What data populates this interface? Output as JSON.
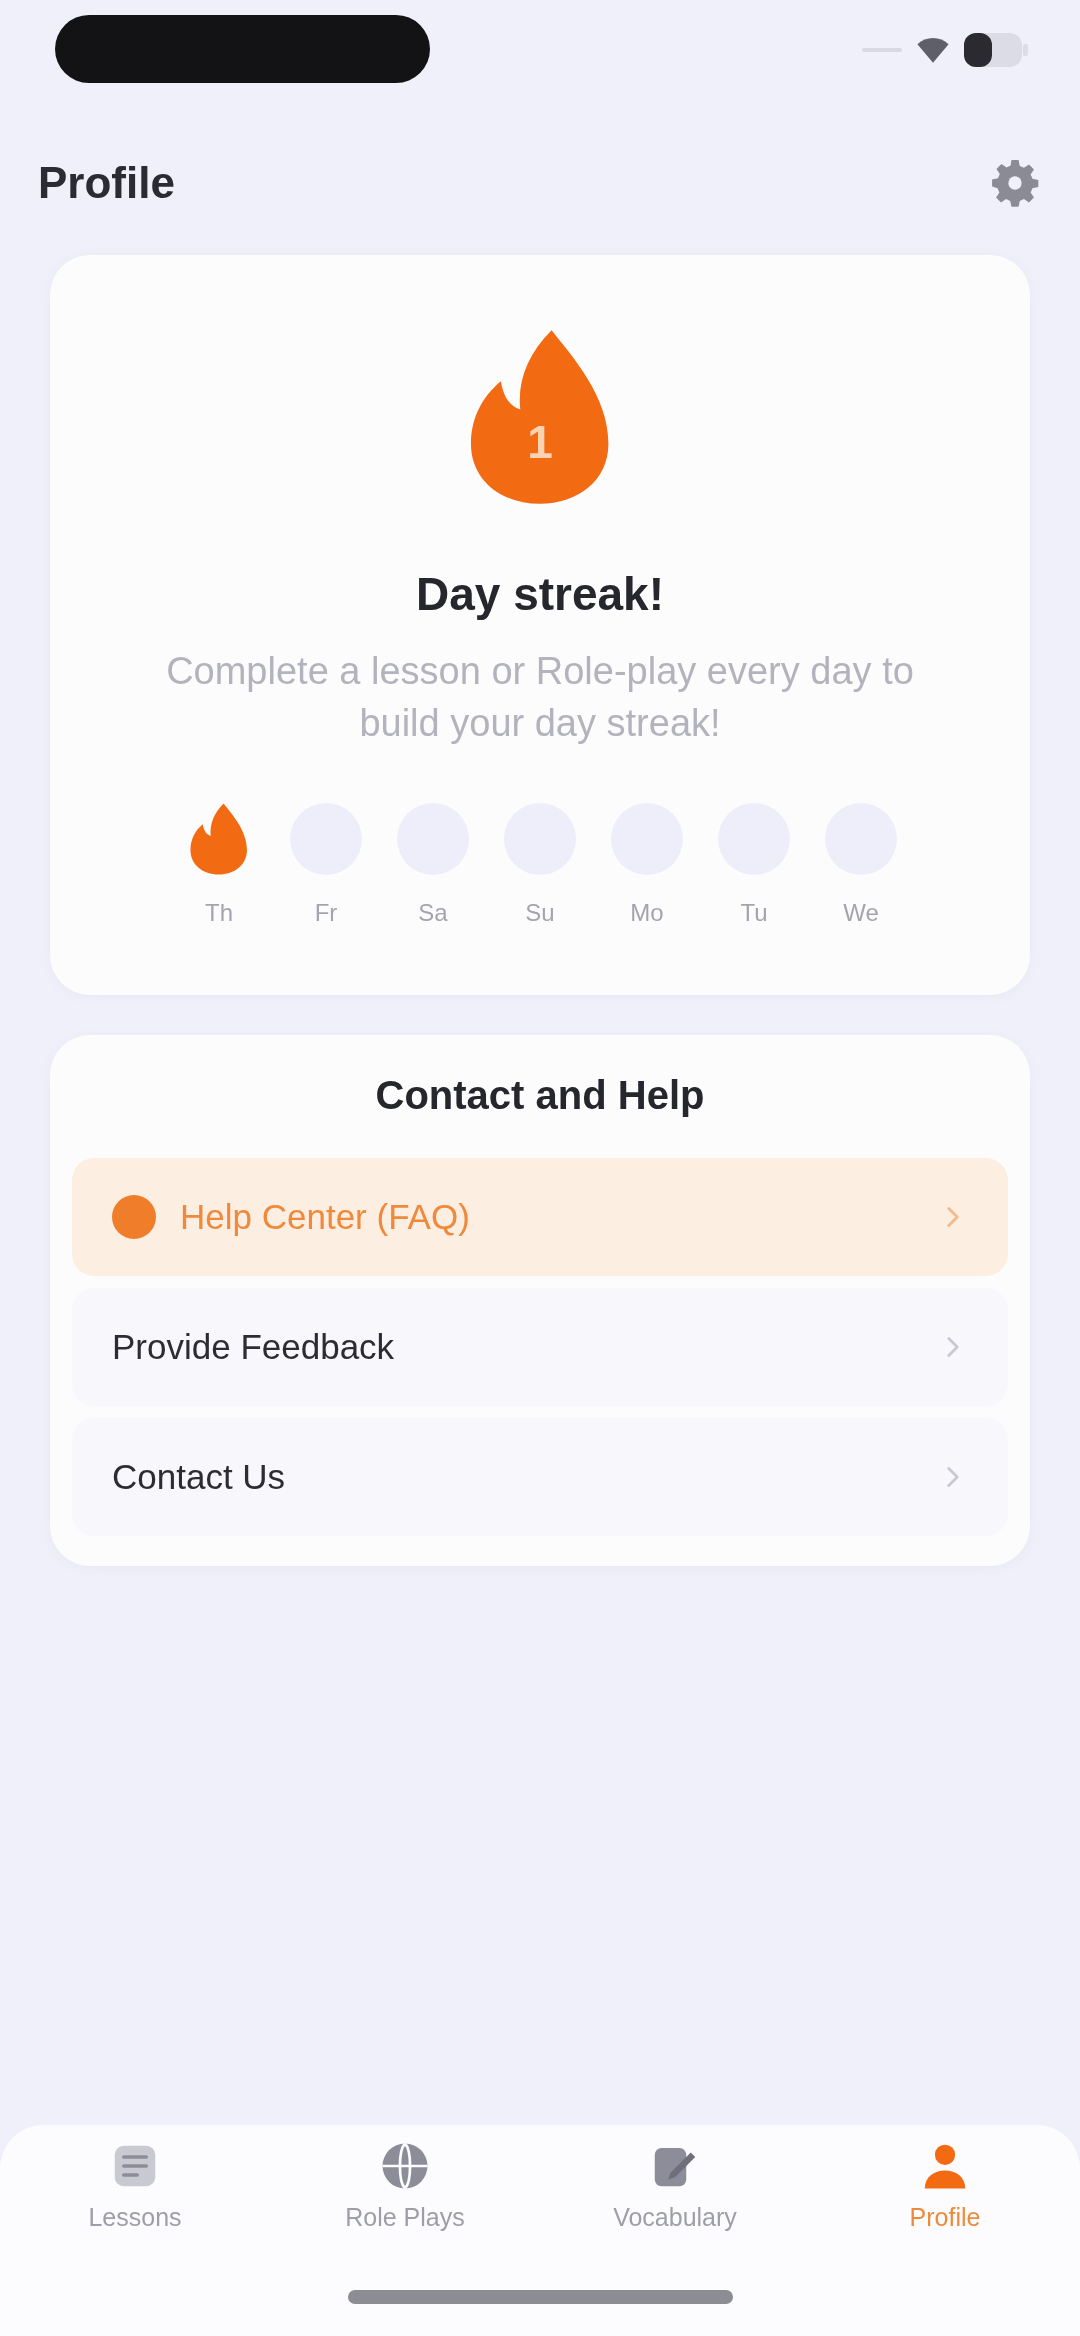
{
  "header": {
    "title": "Profile"
  },
  "streak": {
    "count": "1",
    "title": "Day streak!",
    "description": "Complete a lesson or Role-play every day to build your day streak!",
    "days": [
      {
        "label": "Th",
        "done": true
      },
      {
        "label": "Fr",
        "done": false
      },
      {
        "label": "Sa",
        "done": false
      },
      {
        "label": "Su",
        "done": false
      },
      {
        "label": "Mo",
        "done": false
      },
      {
        "label": "Tu",
        "done": false
      },
      {
        "label": "We",
        "done": false
      }
    ]
  },
  "contact": {
    "title": "Contact and Help",
    "items": [
      {
        "label": "Help Center (FAQ)",
        "selected": true
      },
      {
        "label": "Provide Feedback",
        "selected": false
      },
      {
        "label": "Contact Us",
        "selected": false
      }
    ]
  },
  "tabs": [
    {
      "label": "Lessons",
      "selected": false
    },
    {
      "label": "Role Plays",
      "selected": false
    },
    {
      "label": "Vocabulary",
      "selected": false
    },
    {
      "label": "Profile",
      "selected": true
    }
  ]
}
